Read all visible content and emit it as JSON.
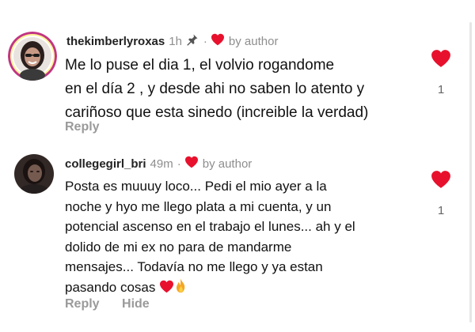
{
  "comments": [
    {
      "username": "thekimberlyroxas",
      "time": "1h",
      "separator": "·",
      "author_label": "by author",
      "pinned": true,
      "lines": [
        "Me lo puse el dia 1, el volvio rogandome",
        "en el día 2 , y desde ahi no saben lo atento y",
        "cariñoso que esta sinedo (increible la verdad)"
      ],
      "reply_label": "Reply",
      "like_count": "1",
      "icons": [
        "pin-icon",
        "heart-icon"
      ]
    },
    {
      "username": "collegegirl_bri",
      "time": "49m",
      "separator": "·",
      "author_label": "by author",
      "pinned": false,
      "lines": [
        "Posta es muuuy loco... Pedi el mio ayer  a la",
        "noche y hyo me llego plata a mi cuenta, y un",
        "potencial ascenso en el trabajo el lunes... ah y el",
        "dolido de mi ex no para de mandarme",
        "mensajes... Todavía no me llego y ya estan",
        "pasando cosas"
      ],
      "reply_label": "Reply",
      "hide_label": "Hide",
      "like_count": "1",
      "icons": [
        "heart-icon",
        "fire-icon"
      ]
    }
  ],
  "colors": {
    "heart": "#e8112d",
    "muted": "#8e8e8e",
    "text": "#111111"
  }
}
